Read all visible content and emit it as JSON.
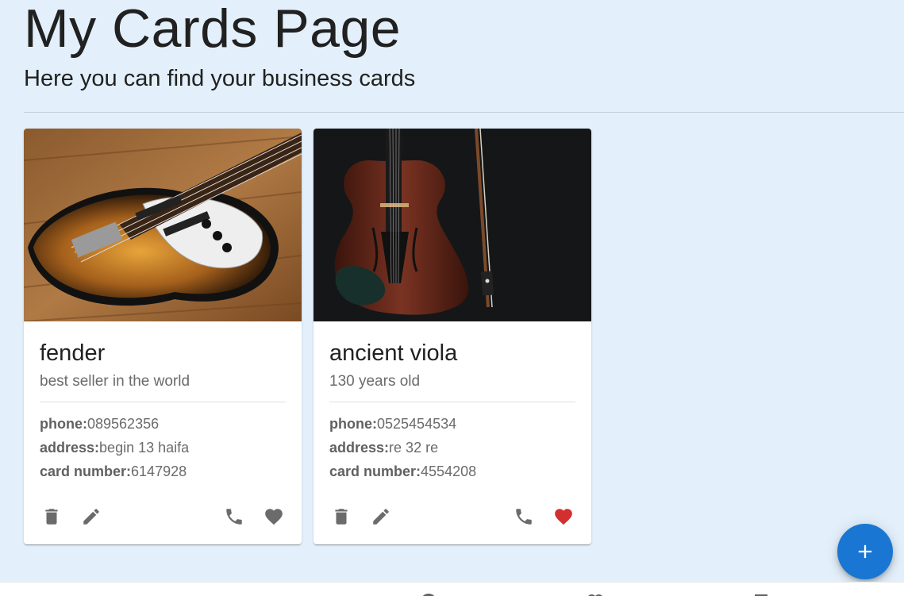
{
  "header": {
    "title": "My Cards Page",
    "subtitle": "Here you can find your business cards"
  },
  "cards": [
    {
      "image": "bass-guitar-photo",
      "title": "fender",
      "subtitle": "best seller in the world",
      "phone_label": "phone:",
      "phone": "089562356",
      "address_label": "address:",
      "address": "begin 13 haifa",
      "card_number_label": "card number:",
      "card_number": "6147928",
      "liked": false
    },
    {
      "image": "viola-photo",
      "title": "ancient viola",
      "subtitle": "130 years old",
      "phone_label": "phone:",
      "phone": "0525454534",
      "address_label": "address:",
      "address": "re 32 re",
      "card_number_label": "card number:",
      "card_number": "4554208",
      "liked": true
    }
  ],
  "icons": {
    "delete": "delete-icon",
    "edit": "edit-icon",
    "call": "phone-icon",
    "favorite": "heart-icon",
    "fab": "plus-icon"
  },
  "colors": {
    "background": "#e3f0fb",
    "fab": "#1976d2",
    "liked": "#d32f2f",
    "icon": "#6b6b6b"
  },
  "bottom_nav": {
    "items": [
      "info-icon",
      "heart-icon",
      "cards-icon"
    ]
  }
}
